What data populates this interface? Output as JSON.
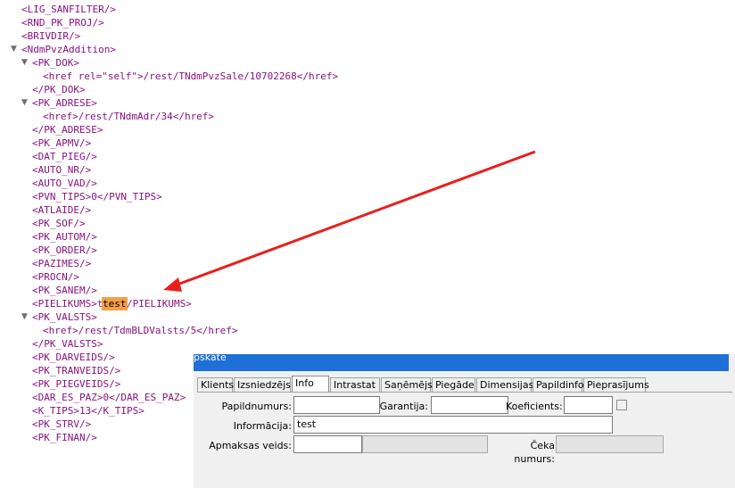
{
  "xml_lines": [
    "<LIG_SANFILTER/>",
    "<RND_PK_PROJ/>",
    "<BRIVDIR/>",
    "<NdmPvzAddition>",
    "<PK_DOK>",
    "<href rel=\"self\">/rest/TNdmPvzSale/10702268</href>",
    "</PK_DOK>",
    "<PK_ADRESE>",
    "<href>/rest/TNdmAdr/34</href>",
    "</PK_ADRESE>",
    "<PK_APMV/>",
    "<DAT_PIEG/>",
    "<AUTO_NR/>",
    "<AUTO_VAD/>",
    "<PVN_TIPS>0</PVN_TIPS>",
    "<ATLAIDE/>",
    "<PK_SOF/>",
    "<PK_AUTOM/>",
    "<PK_ORDER/>",
    "<PAZIMES/>",
    "<PROCN/>",
    "<PK_SANEM/>",
    "<PIELIKUMS>test</PIELIKUMS>",
    "<PK_VALSTS>",
    "<href>/rest/TdmBLDValsts/5</href>",
    "</PK_VALSTS>",
    "<PK_DARVEIDS/>",
    "<PK_TRANVEIDS/>",
    "<PK_PIEGVEIDS/>",
    "<DAR_ES_PAZ>0</DAR_ES_PAZ>",
    "<K_TIPS>13</K_TIPS>",
    "<PK_STRV/>",
    "<PK_FINAN/>"
  ],
  "xml_highlight_text": "test",
  "form": {
    "title": "pskate",
    "tabs": [
      "Klients",
      "Izsniedzējs",
      "Info",
      "Intrastat",
      "Saņēmējs",
      "Piegāde",
      "Dimensijas",
      "Papildinfo",
      "Pieprasījums"
    ],
    "active_tab": "Info",
    "labels": {
      "papildnumurs": "Papildnumurs:",
      "garantija": "Garantija:",
      "koeficients": "Koeficients:",
      "informacija": "Informācija:",
      "apmaksas_veids": "Apmaksas veids:",
      "ceka_numurs": "Čeka numurs:"
    },
    "values": {
      "papildnumurs": "",
      "garantija": "",
      "koeficients": "",
      "informacija": "test",
      "apmaksas_veids": "",
      "apmaksas_veids_extra": "",
      "ceka_numurs": ""
    }
  },
  "colors": {
    "arrow": "#e8201c",
    "highlight": "#f4a048",
    "titlebar": "#1e6fd6"
  }
}
